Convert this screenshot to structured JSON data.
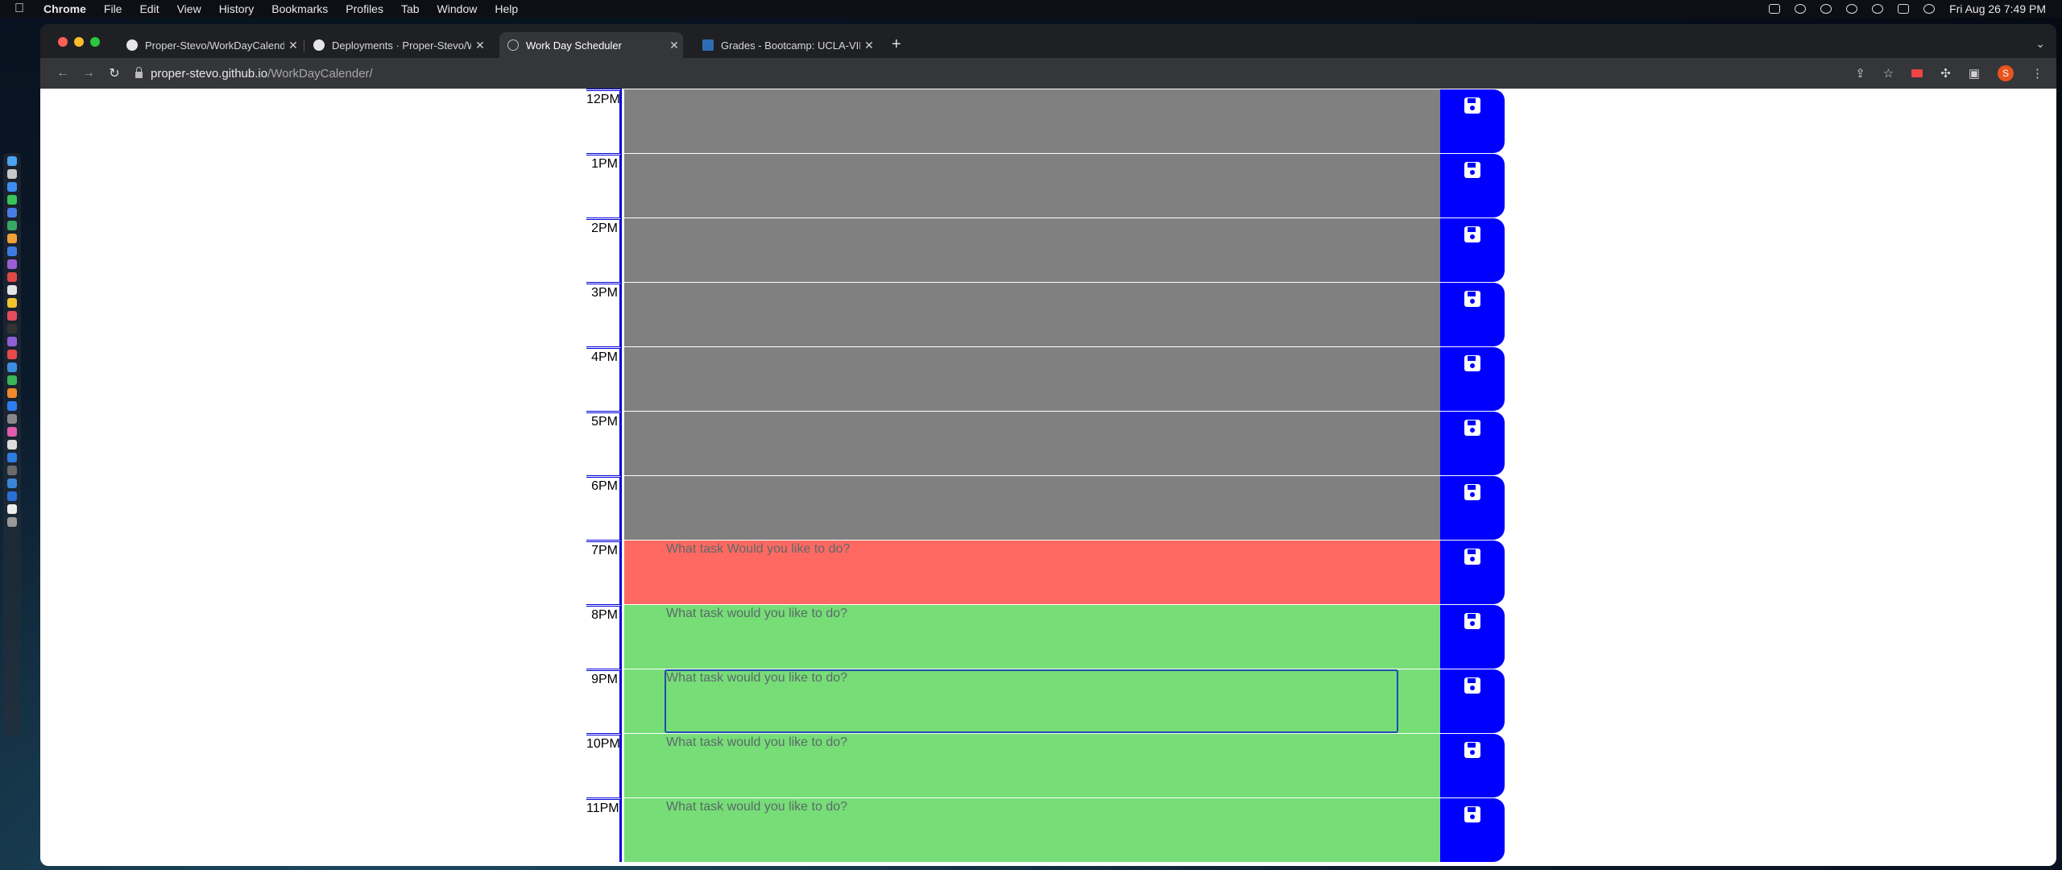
{
  "menubar": {
    "app": "Chrome",
    "items": [
      "File",
      "Edit",
      "View",
      "History",
      "Bookmarks",
      "Profiles",
      "Tab",
      "Window",
      "Help"
    ],
    "clock": "Fri Aug 26  7:49 PM"
  },
  "tabs": [
    {
      "label": "Proper-Stevo/WorkDayCalender",
      "icon": "github-icon",
      "active": false
    },
    {
      "label": "Deployments · Proper-Stevo/W",
      "icon": "github-icon",
      "active": false
    },
    {
      "label": "Work Day Scheduler",
      "icon": "globe-icon",
      "active": true
    },
    {
      "label": "Grades - Bootcamp: UCLA-VIR",
      "icon": "ucla-icon",
      "active": false
    }
  ],
  "address": {
    "host": "proper-stevo.github.io",
    "path": "/WorkDayCalender/"
  },
  "profile_initial": "S",
  "scheduler": {
    "rows": [
      {
        "hour": "12PM",
        "state": "past",
        "placeholder": ""
      },
      {
        "hour": "1PM",
        "state": "past",
        "placeholder": ""
      },
      {
        "hour": "2PM",
        "state": "past",
        "placeholder": ""
      },
      {
        "hour": "3PM",
        "state": "past",
        "placeholder": ""
      },
      {
        "hour": "4PM",
        "state": "past",
        "placeholder": ""
      },
      {
        "hour": "5PM",
        "state": "past",
        "placeholder": ""
      },
      {
        "hour": "6PM",
        "state": "past",
        "placeholder": ""
      },
      {
        "hour": "7PM",
        "state": "present",
        "placeholder": "What task Would you like to do?"
      },
      {
        "hour": "8PM",
        "state": "future",
        "placeholder": "What task would you like to do?"
      },
      {
        "hour": "9PM",
        "state": "future",
        "placeholder": "What task would you like to do?",
        "focused": true
      },
      {
        "hour": "10PM",
        "state": "future",
        "placeholder": "What task would you like to do?"
      },
      {
        "hour": "11PM",
        "state": "future",
        "placeholder": "What task would you like to do?"
      }
    ]
  },
  "colors": {
    "past": "#808080",
    "present": "#ff6961",
    "future": "#77dd77",
    "save_button": "#0000ff",
    "hour_border": "#0000d8"
  }
}
